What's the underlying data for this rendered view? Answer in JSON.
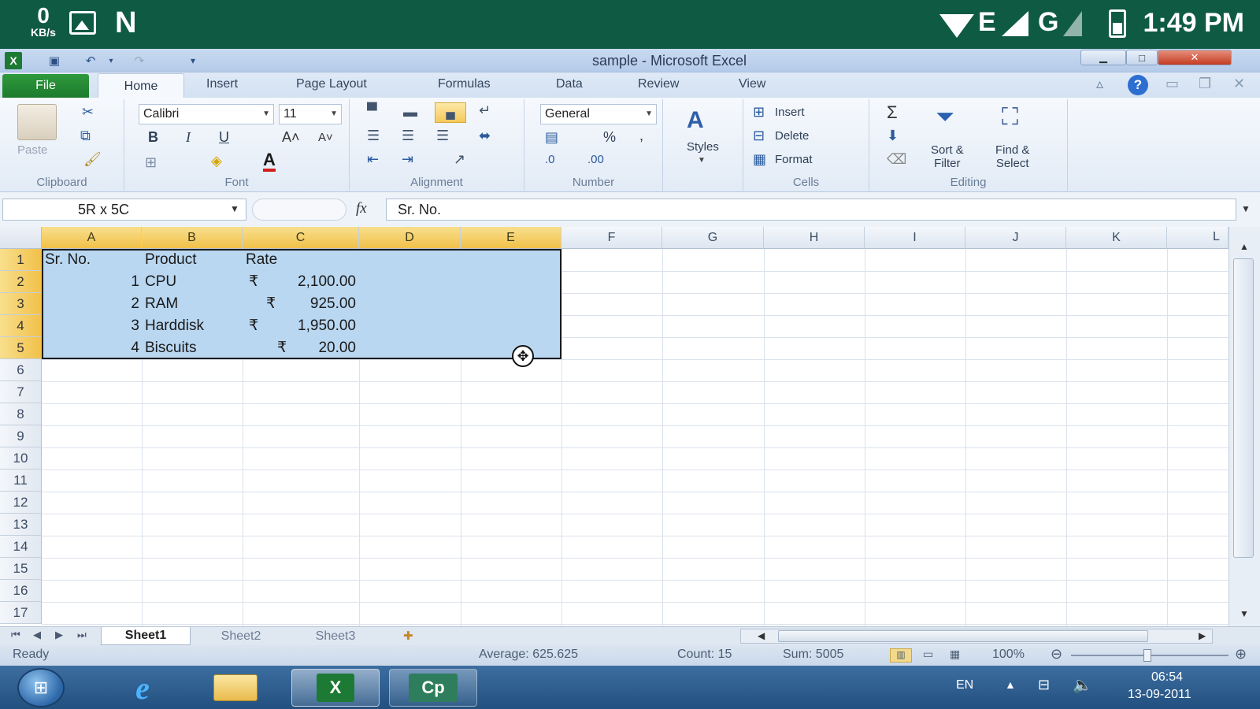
{
  "android_status": {
    "speed_value": "0",
    "speed_unit": "KB/s",
    "network_1": "E",
    "network_2": "G",
    "time": "1:49 PM"
  },
  "window": {
    "title": "sample - Microsoft Excel"
  },
  "ribbon_tabs": {
    "file": "File",
    "home": "Home",
    "insert": "Insert",
    "page_layout": "Page Layout",
    "formulas": "Formulas",
    "data": "Data",
    "review": "Review",
    "view": "View"
  },
  "ribbon": {
    "clipboard": {
      "label": "Clipboard",
      "paste": "Paste"
    },
    "font": {
      "label": "Font",
      "name": "Calibri",
      "size": "11",
      "bold": "B",
      "italic": "I",
      "underline": "U"
    },
    "alignment": {
      "label": "Alignment"
    },
    "number": {
      "label": "Number",
      "format": "General",
      "percent": "%"
    },
    "styles": {
      "label": "Styles"
    },
    "cells": {
      "label": "Cells",
      "insert": "Insert",
      "delete": "Delete",
      "format": "Format"
    },
    "editing": {
      "label": "Editing",
      "sort_line1": "Sort &",
      "sort_line2": "Filter",
      "find_line1": "Find &",
      "find_line2": "Select"
    }
  },
  "formula_bar": {
    "name_box": "5R x 5C",
    "fx": "fx",
    "value": "Sr. No."
  },
  "columns": [
    "A",
    "B",
    "C",
    "D",
    "E",
    "F",
    "G",
    "H",
    "I",
    "J",
    "K",
    "L"
  ],
  "rows": [
    "1",
    "2",
    "3",
    "4",
    "5",
    "6",
    "7",
    "8",
    "9",
    "10",
    "11",
    "12",
    "13",
    "14",
    "15",
    "16",
    "17"
  ],
  "table": {
    "headers": [
      "Sr. No.",
      "Product",
      "Rate"
    ],
    "rows": [
      {
        "sr": "1",
        "product": "CPU",
        "currency": "₹",
        "rate": "2,100.00"
      },
      {
        "sr": "2",
        "product": "RAM",
        "currency": "₹",
        "rate": "925.00"
      },
      {
        "sr": "3",
        "product": "Harddisk",
        "currency": "₹",
        "rate": "1,950.00"
      },
      {
        "sr": "4",
        "product": "Biscuits",
        "currency": "₹",
        "rate": "20.00"
      }
    ]
  },
  "sheets": [
    "Sheet1",
    "Sheet2",
    "Sheet3"
  ],
  "status_bar": {
    "mode": "Ready",
    "average": "Average: 625.625",
    "count": "Count: 15",
    "sum": "Sum: 5005",
    "zoom": "100%"
  },
  "taskbar": {
    "app": "Cp",
    "lang": "EN",
    "time": "06:54",
    "date": "13-09-2011"
  },
  "colors": {
    "status_green": "#0f5a43",
    "file_green": "#1c7a2c",
    "selection_fill": "#b9d7f1",
    "header_selected": "#f1c14a",
    "taskbar_blue": "#22507f"
  }
}
